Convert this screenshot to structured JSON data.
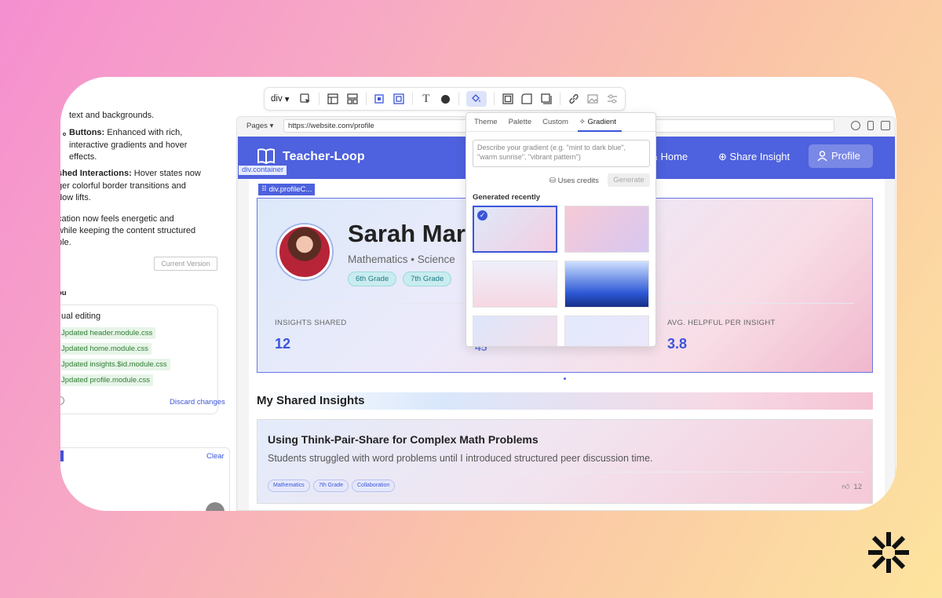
{
  "chat": {
    "line1": "text and backgrounds.",
    "buttons_bold": "Buttons:",
    "buttons_text": " Enhanced with rich,",
    "line3": "interactive gradients and hover",
    "line4": "effects.",
    "polished_bold": "shed Interactions:",
    "polished_text": " Hover states now",
    "line6": "ger colorful border transitions and",
    "line7": "dow lifts.",
    "line8": "cation now feels energetic and",
    "line9": "while keeping the content structured",
    "line10": "ble.",
    "current_version": "Current Version",
    "you_label": "ou",
    "card_title": "ual editing",
    "files": [
      "Jpdated header.module.css",
      "Jpdated home.module.css",
      "Jpdated insights.$id.module.css",
      "Jpdated profile.module.css"
    ],
    "discard": "Discard changes",
    "clear": "Clear"
  },
  "toolbar": {
    "element_select": "div"
  },
  "browser": {
    "pages_label": "Pages",
    "url": "https://website.com/profile"
  },
  "site": {
    "logo": "Teacher-Loop",
    "nav": {
      "home": "Home",
      "share": "Share Insight",
      "profile": "Profile"
    },
    "label_container": "div.container",
    "label_profile": "div.profileC...",
    "profile": {
      "name": "Sarah Mart",
      "subjects": "Mathematics • Science",
      "grades": [
        "6th Grade",
        "7th Grade"
      ],
      "stats": [
        {
          "label": "INSIGHTS SHARED",
          "value": "12"
        },
        {
          "label": "AVG. HELPFUL PER INSIGHT",
          "value": "3.8"
        }
      ],
      "hidden_stat_value": "45"
    },
    "section_title": "My Shared Insights",
    "insight": {
      "title": "Using Think-Pair-Share for Complex Math Problems",
      "desc": "Students struggled with word problems until I introduced structured peer discussion time.",
      "tags": [
        "Mathematics",
        "7th Grade",
        "Collaboration"
      ],
      "likes": "12"
    }
  },
  "popover": {
    "tabs": [
      "Theme",
      "Palette",
      "Custom",
      "Gradient"
    ],
    "active_tab": "Gradient",
    "placeholder": "Describe your gradient (e.g. \"mint to dark blue\", \"warm sunrise\", \"vibrant pattern\")",
    "uses_credits": "Uses credits",
    "generate": "Generate",
    "generated_recently": "Generated recently",
    "swatches": [
      "linear-gradient(135deg,#dde9fa,#f3cde0)",
      "linear-gradient(135deg,#f6c9d6,#d7c8f1)",
      "linear-gradient(180deg,#eef0fb,#f6d7e3)",
      "linear-gradient(180deg,#cfe0ff,#2d58d6 70%,#162e86)",
      "linear-gradient(135deg,#dde6fb,#f6dde7)",
      "linear-gradient(135deg,#e3e9fc,#ece8fb)"
    ]
  }
}
